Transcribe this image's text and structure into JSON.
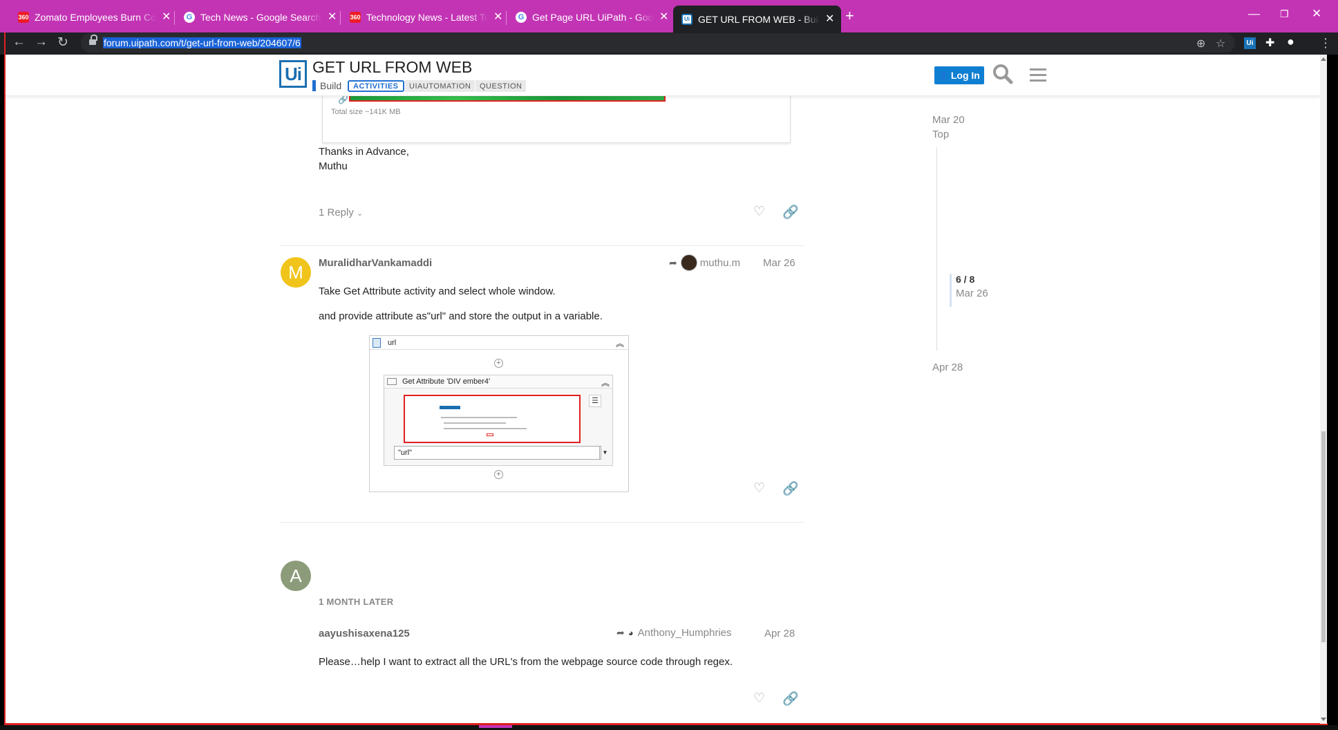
{
  "browser": {
    "tabs": [
      {
        "title": "Zomato Employees Burn Compan",
        "favicon": "360"
      },
      {
        "title": "Tech News - Google Search",
        "favicon": "G"
      },
      {
        "title": "Technology News - Latest Tech N",
        "favicon": "360"
      },
      {
        "title": "Get Page URL UiPath - Google Se",
        "favicon": "G"
      },
      {
        "title": "GET URL FROM WEB - Build - UiP",
        "favicon": "Ui",
        "active": true
      }
    ],
    "url": "forum.uipath.com/t/get-url-from-web/204607/6",
    "accent_color": "#c334b5"
  },
  "header": {
    "logo_text": "Ui",
    "title": "GET URL FROM WEB",
    "category": "Build",
    "tags": [
      "ACTIVITIES",
      "UIAUTOMATION",
      "QUESTION"
    ],
    "login_label": "Log In"
  },
  "previous_post": {
    "attachment_size": "Total size ~141K MB",
    "line1": "Thanks in Advance,",
    "line2": "Muthu",
    "replies": "1 Reply"
  },
  "post6": {
    "avatar_letter": "M",
    "avatar_color": "#f0c41b",
    "username": "MuralidharVankamaddi",
    "reply_to": "muthu.m",
    "date": "Mar 26",
    "para1": "Take Get Attribute activity and select whole window.",
    "para2": "and provide attribute as\"url\" and store the output in a variable.",
    "image": {
      "sequence_name": "url",
      "activity_name": "Get Attribute 'DIV  ember4'",
      "attribute_value": "\"url\""
    }
  },
  "gap_label": "1 MONTH LATER",
  "post7": {
    "avatar_letter": "A",
    "avatar_color": "#8c9b7a",
    "username": "aayushisaxena125",
    "reply_to": "Anthony_Humphries",
    "date": "Apr 28",
    "body": "Please…help I want to extract all the URL's from the webpage source code through regex."
  },
  "timeline": {
    "start": "Mar 20",
    "top": "Top",
    "position": "6 / 8",
    "position_date": "Mar 26",
    "end": "Apr 28"
  }
}
